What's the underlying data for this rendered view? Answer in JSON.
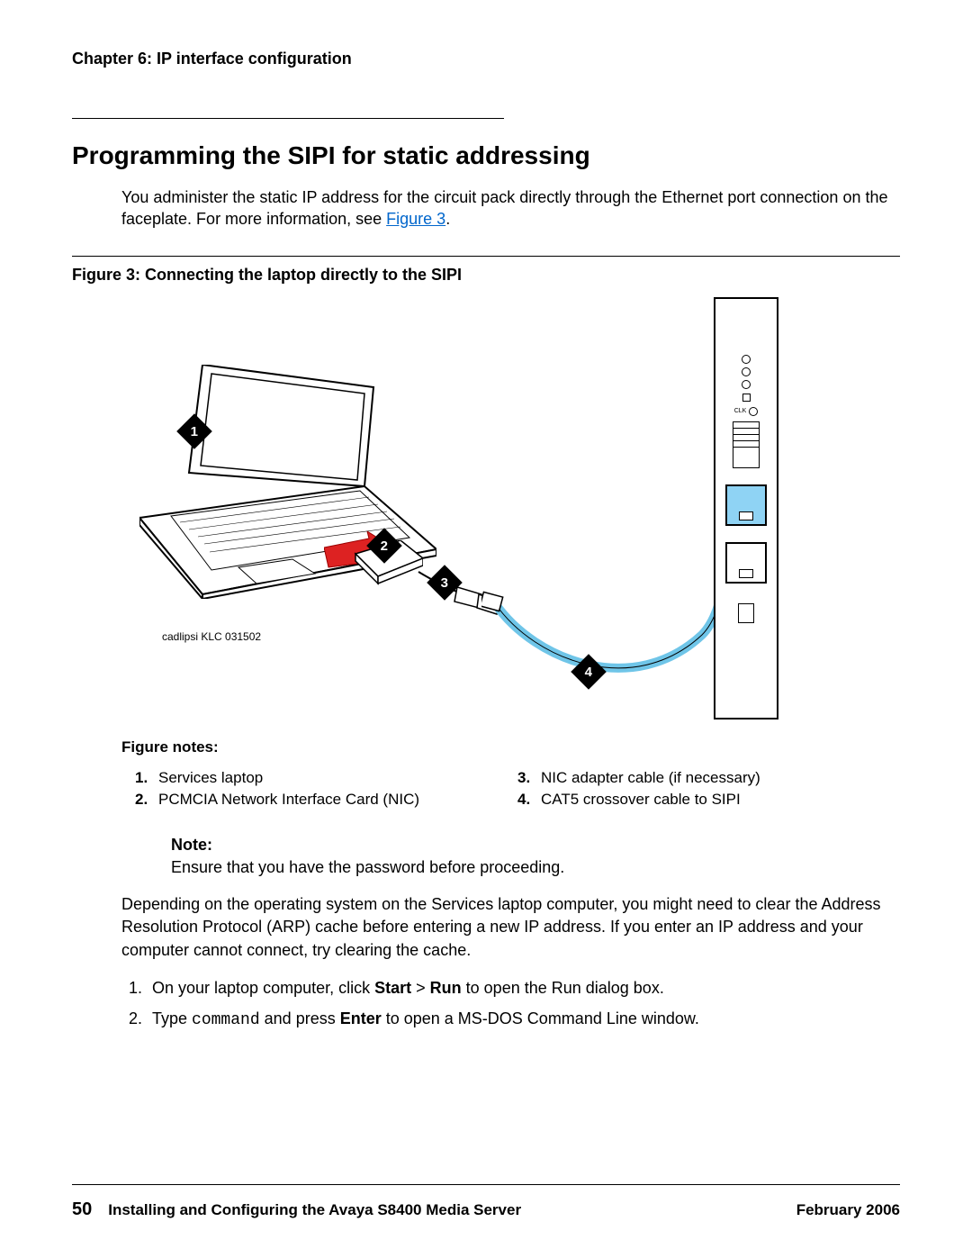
{
  "chapter_header": "Chapter 6: IP interface configuration",
  "section_title": "Programming the SIPI for static addressing",
  "intro": {
    "text_before_link": "You administer the static IP address for the circuit pack directly through the Ethernet port connection on the faceplate. For more information, see ",
    "link_text": "Figure 3",
    "text_after_link": "."
  },
  "figure": {
    "caption": "Figure 3: Connecting the laptop directly to the SIPI",
    "image_credit": "cadlipsi KLC 031502",
    "sipi_clk_label": "CLK",
    "callouts": {
      "1": "1",
      "2": "2",
      "3": "3",
      "4": "4"
    }
  },
  "figure_notes": {
    "label": "Figure notes:",
    "items": [
      {
        "num": "1.",
        "text": "Services laptop"
      },
      {
        "num": "2.",
        "text": "PCMCIA Network Interface Card (NIC)"
      },
      {
        "num": "3.",
        "text": "NIC adapter cable (if necessary)"
      },
      {
        "num": "4.",
        "text": "CAT5 crossover cable to SIPI"
      }
    ]
  },
  "note": {
    "label": "Note:",
    "text": "Ensure that you have the password before proceeding."
  },
  "body_para": "Depending on the operating system on the Services laptop computer, you might need to clear the Address Resolution Protocol (ARP) cache before entering a new IP address. If you enter an IP address and your computer cannot connect, try clearing the cache.",
  "steps": {
    "1": {
      "pre": "On your laptop computer, click ",
      "bold1": "Start",
      "mid": " > ",
      "bold2": "Run",
      "post": " to open the Run dialog box."
    },
    "2": {
      "pre": "Type ",
      "code": "command",
      "mid": " and press ",
      "bold": "Enter",
      "post": " to open a MS-DOS Command Line window."
    }
  },
  "footer": {
    "page_number": "50",
    "doc_title": "Installing and Configuring the Avaya S8400 Media Server",
    "date": "February 2006"
  }
}
